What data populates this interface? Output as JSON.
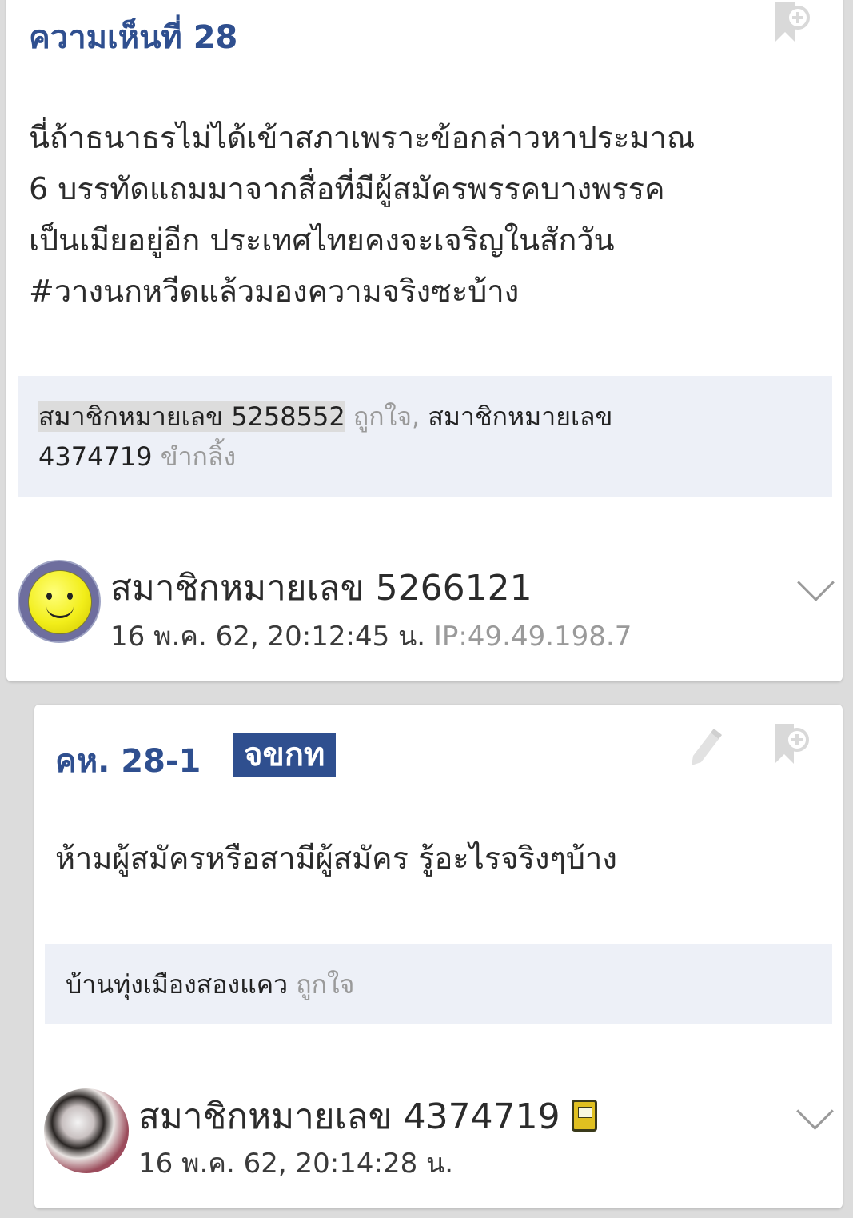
{
  "comment": {
    "title": "ความเห็นที่ 28",
    "body_lines": [
      "นี่ถ้าธนาธรไม่ได้เข้าสภาเพราะข้อกล่าวหาประมาณ",
      "6 บรรทัดแถมมาจากสื่อที่มีผู้สมัครพรรคบางพรรค",
      "เป็นเมียอยู่อีก ประเทศไทยคงจะเจริญในสักวัน",
      "#วางนกหวีดแล้วมองความจริงซะบ้าง"
    ],
    "reactions": {
      "member1": "สมาชิกหมายเลข 5258552",
      "reaction1": "ถูกใจ,",
      "member2": "สมาชิกหมายเลข",
      "member2_id": "4374719",
      "reaction2": "ขำกลิ้ง"
    },
    "author": "สมาชิกหมายเลข 5266121",
    "timestamp": "16 พ.ค. 62, 20:12:45 น.",
    "ip": "IP:49.49.198.7",
    "avatar_icon": "smiley-avatar",
    "bookmark_icon": "bookmark-add-icon",
    "chevron_icon": "chevron-down-icon"
  },
  "reply": {
    "title": "คห. 28-1",
    "badge": "จขกท",
    "body": "ห้ามผู้สมัครหรือสามีผู้สมัคร รู้อะไรจริงๆบ้าง",
    "reactions": {
      "member": "บ้านทุ่งเมืองสองแคว",
      "reaction": "ถูกใจ"
    },
    "author": "สมาชิกหมายเลข 4374719",
    "timestamp": "16 พ.ค. 62, 20:14:28 น.",
    "avatar_icon": "puppy-avatar",
    "edit_icon": "pencil-edit-icon",
    "bookmark_icon": "bookmark-add-icon",
    "chevron_icon": "chevron-down-icon",
    "device_icon": "mobile-phone-icon"
  },
  "colors": {
    "accent": "#2f4f8f",
    "reaction_bg": "#edf0f7",
    "muted": "#9a9a9a"
  }
}
